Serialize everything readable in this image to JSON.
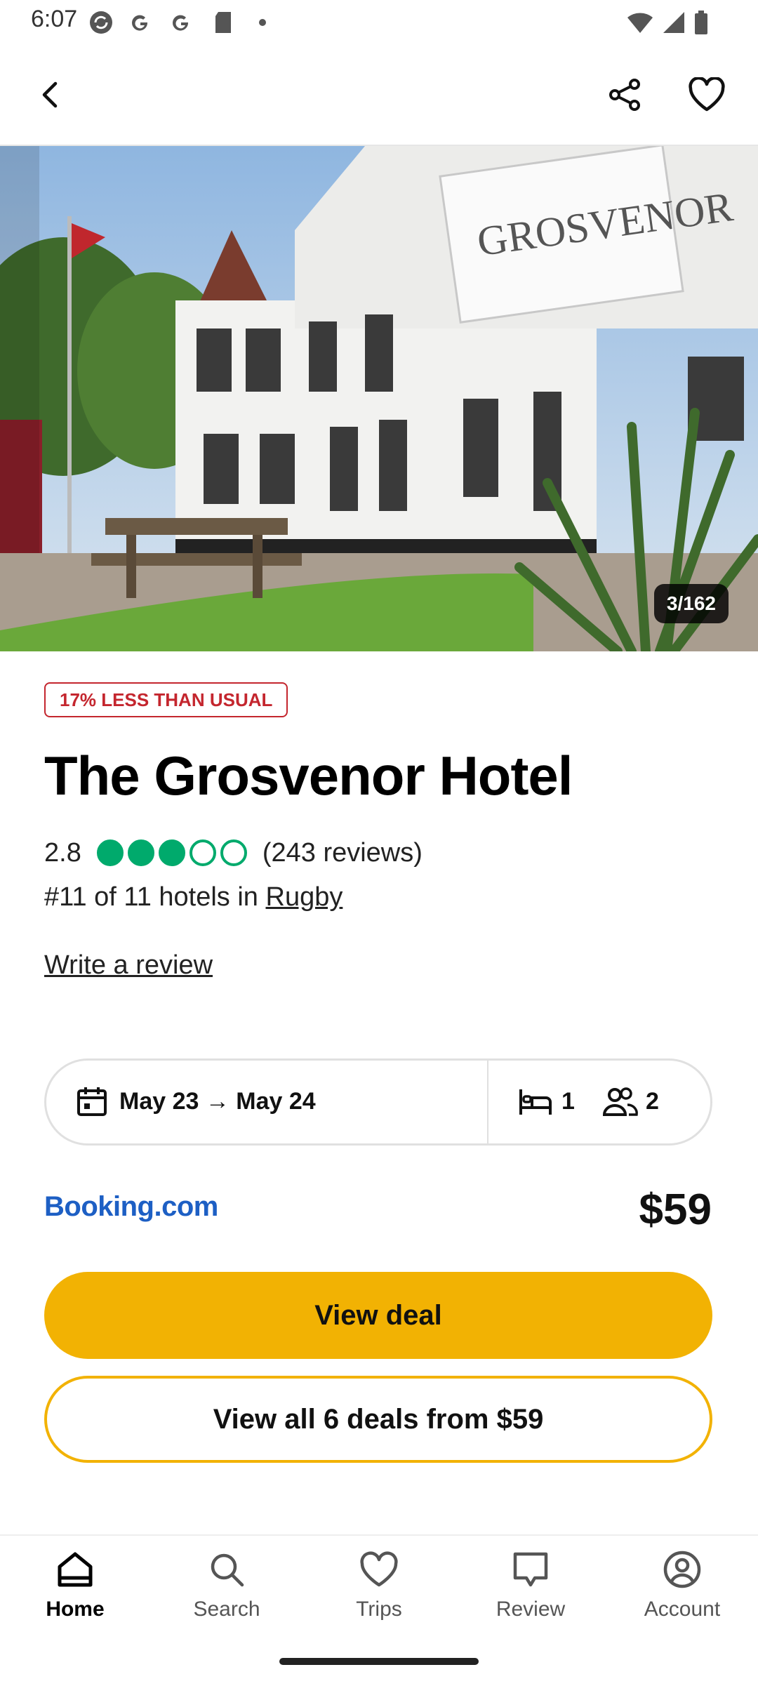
{
  "status_bar": {
    "time": "6:07"
  },
  "hero": {
    "photo_counter": "3/162"
  },
  "hotel": {
    "badge": "17% LESS THAN USUAL",
    "name": "The Grosvenor Hotel",
    "rating": "2.8",
    "rating_bubbles_filled": 3,
    "rating_bubbles_total": 5,
    "reviews": "(243 reviews)",
    "rank_prefix": "#11 of 11 hotels in ",
    "rank_city": "Rugby",
    "write_review": "Write a review"
  },
  "search": {
    "dates": "May 23 → May 24",
    "rooms": "1",
    "guests": "2"
  },
  "deal": {
    "provider": "Booking.com",
    "price": "$59",
    "view_deal_label": "View deal",
    "view_all_label": "View all 6 deals from $59"
  },
  "nav": {
    "items": [
      {
        "label": "Home",
        "icon": "home-icon",
        "active": true
      },
      {
        "label": "Search",
        "icon": "search-icon",
        "active": false
      },
      {
        "label": "Trips",
        "icon": "heart-icon",
        "active": false
      },
      {
        "label": "Review",
        "icon": "review-icon",
        "active": false
      },
      {
        "label": "Account",
        "icon": "account-icon",
        "active": false
      }
    ]
  },
  "colors": {
    "accent_yellow": "#f2b203",
    "rating_green": "#00aa6c",
    "badge_red": "#c4262e",
    "provider_blue": "#1d5fc4"
  }
}
